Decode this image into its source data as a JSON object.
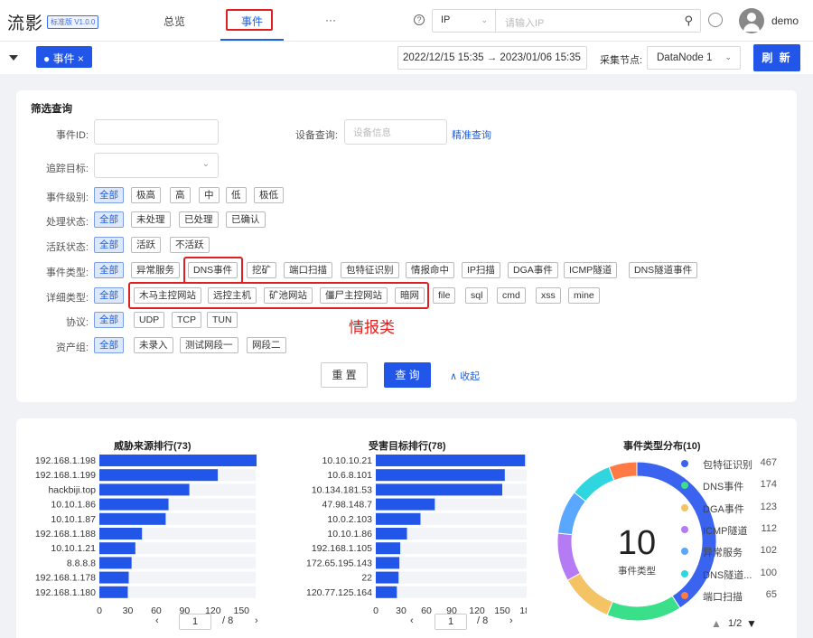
{
  "app": {
    "logo": "流影",
    "version": "标准版 V1.0.0",
    "user": "demo"
  },
  "nav": {
    "overview": "总览",
    "events": "事件",
    "more": "···"
  },
  "header": {
    "ip_type": "IP",
    "search_placeholder": "请输入IP"
  },
  "tabbar": {
    "tab_label": "● 事件 ×",
    "date_range": "2022/12/15 15:35 → 2023/01/06 15:35",
    "node_label": "采集节点:",
    "node_value": "DataNode 1",
    "refresh": "刷 新"
  },
  "filter": {
    "title": "筛选查询",
    "event_id_label": "事件ID:",
    "device_label": "设备查询:",
    "device_placeholder": "设备信息",
    "precise_query": "精准查询",
    "trace_label": "追踪目标:",
    "level_label": "事件级别:",
    "levels": [
      "全部",
      "极高",
      "高",
      "中",
      "低",
      "极低"
    ],
    "state_label": "处理状态:",
    "states": [
      "全部",
      "未处理",
      "已处理",
      "已确认"
    ],
    "active_label": "活跃状态:",
    "actives": [
      "全部",
      "活跃",
      "不活跃"
    ],
    "type_label": "事件类型:",
    "types": [
      "全部",
      "异常服务",
      "DNS事件",
      "挖矿",
      "端口扫描",
      "包特征识别",
      "情报命中",
      "IP扫描",
      "DGA事件",
      "ICMP隧道",
      "DNS隧道事件"
    ],
    "detail_label": "详细类型:",
    "details": [
      "全部",
      "木马主控网站",
      "远控主机",
      "矿池网站",
      "僵尸主控网站",
      "暗网",
      "file",
      "sql",
      "cmd",
      "xss",
      "mine"
    ],
    "proto_label": "协议:",
    "protos": [
      "全部",
      "UDP",
      "TCP",
      "TUN"
    ],
    "asset_label": "资产组:",
    "assets": [
      "全部",
      "未录入",
      "测试网段一",
      "网段二"
    ],
    "annotation": "情报类",
    "reset": "重 置",
    "query": "查 询",
    "collapse": "∧ 收起"
  },
  "chart_data": [
    {
      "type": "bar",
      "title": "威胁来源排行(73)",
      "categories": [
        "192.168.1.198",
        "192.168.1.199",
        "hackbiji.top",
        "10.10.1.86",
        "10.10.1.87",
        "192.168.1.188",
        "10.10.1.21",
        "8.8.8.8",
        "192.168.1.178",
        "192.168.1.180"
      ],
      "values": [
        166,
        125,
        95,
        73,
        70,
        45,
        38,
        34,
        31,
        30
      ],
      "xticks": [
        "0",
        "30",
        "60",
        "90",
        "120",
        "150"
      ],
      "xlim": [
        0,
        165
      ],
      "page": "1",
      "total": "/ 8"
    },
    {
      "type": "bar",
      "title": "受害目标排行(78)",
      "categories": [
        "10.10.10.21",
        "10.6.8.101",
        "10.134.181.53",
        "47.98.148.7",
        "10.0.2.103",
        "10.10.1.86",
        "192.168.1.105",
        "172.65.195.143",
        "22",
        "120.77.125.164"
      ],
      "values": [
        177,
        153,
        150,
        70,
        53,
        37,
        29,
        28,
        27,
        25
      ],
      "xticks": [
        "0",
        "30",
        "60",
        "90",
        "120",
        "150",
        "180"
      ],
      "xlim": [
        0,
        180
      ],
      "page": "1",
      "total": "/ 8"
    },
    {
      "type": "pie",
      "title": "事件类型分布(10)",
      "center_value": "10",
      "center_label": "事件类型",
      "labels": [
        "包特征识别",
        "DNS事件",
        "DGA事件",
        "ICMP隧道",
        "异常服务",
        "DNS隧道...",
        "端口扫描"
      ],
      "values": [
        467,
        174,
        123,
        112,
        102,
        100,
        65
      ],
      "value_labels": [
        "467",
        "174",
        "123",
        "112",
        "102",
        "100",
        "65"
      ],
      "colors": [
        "#3a63f0",
        "#3adf8a",
        "#f4c363",
        "#b57bf5",
        "#5aa7ff",
        "#2fd6e0",
        "#ff7a45"
      ],
      "page": "1/2"
    }
  ]
}
